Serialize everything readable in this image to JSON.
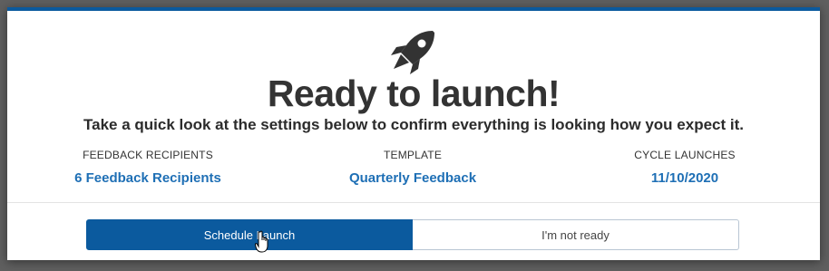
{
  "modal": {
    "icon": "rocket-icon",
    "title": "Ready to launch!",
    "subtitle": "Take a quick look at the settings below to confirm everything is looking how you expect it.",
    "settings": [
      {
        "label": "FEEDBACK RECIPIENTS",
        "value": "6 Feedback Recipients"
      },
      {
        "label": "TEMPLATE",
        "value": "Quarterly Feedback"
      },
      {
        "label": "CYCLE LAUNCHES",
        "value": "11/10/2020"
      }
    ],
    "buttons": {
      "schedule_label": "Schedule Launch",
      "not_ready_label": "I'm not ready"
    }
  },
  "colors": {
    "accent": "#0b5a9e",
    "link": "#1e6fb5",
    "heading": "#333333"
  },
  "cursor_icon": "hand-pointer-icon"
}
